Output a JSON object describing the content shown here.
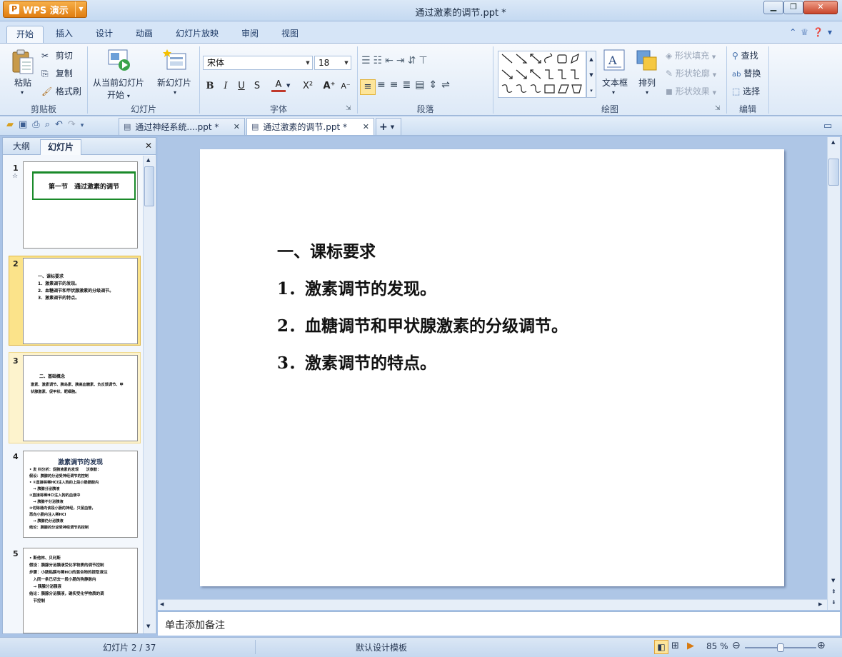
{
  "app": {
    "name": "WPS 演示",
    "window_title": "通过激素的调节.ppt *"
  },
  "ribbon_tabs": [
    "开始",
    "插入",
    "设计",
    "动画",
    "幻灯片放映",
    "审阅",
    "视图"
  ],
  "clipboard": {
    "paste": "粘贴",
    "cut": "剪切",
    "copy": "复制",
    "format_painter": "格式刷",
    "group": "剪贴板"
  },
  "slides_group": {
    "from_current_line1": "从当前幻灯片",
    "from_current_line2": "开始",
    "new_slide": "新幻灯片",
    "group": "幻灯片"
  },
  "font": {
    "name": "宋体",
    "size": "18",
    "group": "字体",
    "bold": "B",
    "italic": "I",
    "underline": "U",
    "shadow": "S",
    "color_a": "A",
    "superscript": "X²",
    "grow": "A⁺",
    "shrink": "A⁻"
  },
  "paragraph": {
    "group": "段落"
  },
  "drawing": {
    "text_box": "文本框",
    "arrange": "排列",
    "shape_fill": "形状填充",
    "shape_outline": "形状轮廓",
    "shape_effect": "形状效果",
    "group": "绘图"
  },
  "editing": {
    "find": "查找",
    "replace": "替换",
    "select": "选择",
    "group": "编辑"
  },
  "doc_tabs": [
    {
      "label": "通过神经系统....ppt *",
      "active": false
    },
    {
      "label": "通过激素的调节.ppt *",
      "active": true
    }
  ],
  "pane_tabs": [
    "大纲",
    "幻灯片"
  ],
  "thumbnails": [
    {
      "num": "1",
      "title": "第一节　通过激素的调节"
    },
    {
      "num": "2",
      "lines": [
        "一、课标要求",
        "1．激素调节的发现。",
        "2．血糖调节和甲状腺激素的分级调节。",
        "3．激素调节的特点。"
      ]
    },
    {
      "num": "3",
      "lines": [
        "二、基础概念",
        "激素、激素调节、胰岛素、胰高血糖素、负反馈调节、甲",
        "状腺激素、促甲状、靶细胞。"
      ]
    },
    {
      "num": "4",
      "title": "激素调节的发现",
      "lines": [
        "• 发 科分析：促胰液素的发现　　沃泰默：",
        "假设：胰腺的分泌受神经调节的控制",
        "• ①直接将稀HCl注入狗的上段小肠肠腔内",
        "　→ 胰腺分泌胰液",
        "②直接将稀HCl注入狗的血液中",
        "　→ 胰腺不分泌胰液",
        "③切除通向该段小肠的神经，只留血管，",
        "再向小肠内注入稀HCl",
        "　→ 胰腺仍分泌胰液",
        "结论：胰腺的分泌受神经调节的控制"
      ]
    },
    {
      "num": "5",
      "lines": [
        "• 斯他林、贝利斯",
        "假设：胰腺分泌胰液受化学物质的调节控制",
        "步骤：小肠粘膜与稀HCl的混合物的提取液注",
        "　入同一条已切去一段小肠的狗静脉内",
        "　→ 胰腺分泌胰液",
        "结论：胰腺分泌胰液，确实受化学物质的调",
        "　节控制"
      ]
    }
  ],
  "slide": {
    "lines": [
      "一、课标要求",
      "1．激素调节的发现。",
      "2．血糖调节和甲状腺激素的分级调节。",
      "3．激素调节的特点。"
    ]
  },
  "notes_placeholder": "单击添加备注",
  "status": {
    "slide_pos": "幻灯片 2 / 37",
    "template": "默认设计模板",
    "zoom": "85 %",
    "zoom_level": 0.5
  }
}
